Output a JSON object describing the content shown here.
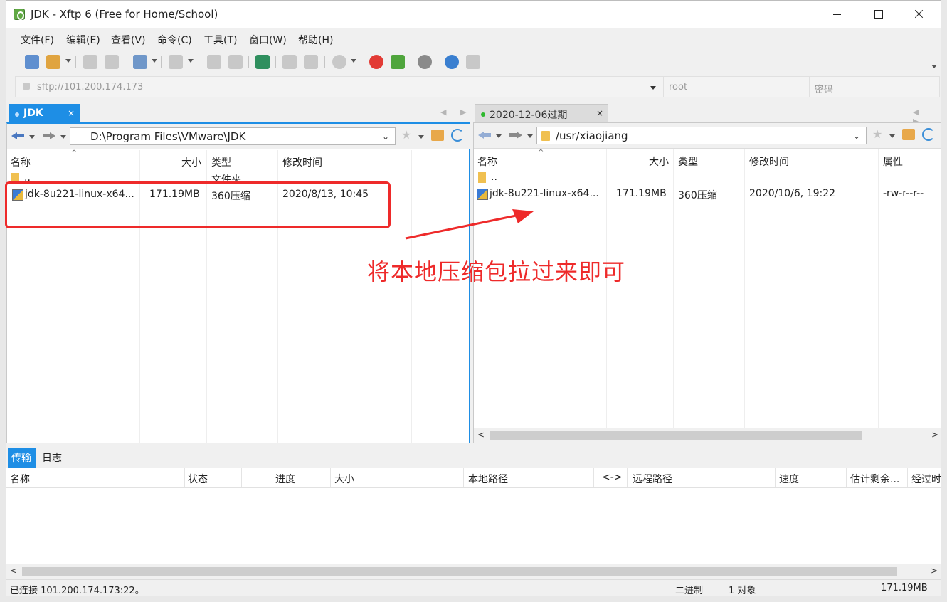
{
  "window": {
    "title": "JDK - Xftp 6 (Free for Home/School)"
  },
  "menu": [
    "文件(F)",
    "编辑(E)",
    "查看(V)",
    "命令(C)",
    "工具(T)",
    "窗口(W)",
    "帮助(H)"
  ],
  "address_bar": {
    "host": "sftp://101.200.174.173",
    "user_placeholder": "root",
    "password_placeholder": "密码"
  },
  "tabs": {
    "left": {
      "label": "JDK",
      "close": "×"
    },
    "right": {
      "label": "2020-12-06过期",
      "close": "×"
    },
    "nav_arrows": "◀ ▶"
  },
  "left_pane": {
    "path": "D:\\Program Files\\VMware\\JDK",
    "columns": [
      "名称",
      "大小",
      "类型",
      "修改时间"
    ],
    "sort_indicator": "^",
    "rows": [
      {
        "name": "..",
        "size": "",
        "type": "文件夹",
        "modified": ""
      },
      {
        "name": "jdk-8u221-linux-x64...",
        "size": "171.19MB",
        "type": "360压缩",
        "modified": "2020/8/13, 10:45"
      }
    ]
  },
  "right_pane": {
    "path": "/usr/xiaojiang",
    "columns": [
      "名称",
      "大小",
      "类型",
      "修改时间",
      "属性"
    ],
    "sort_indicator": "^",
    "rows": [
      {
        "name": "..",
        "size": "",
        "type": "",
        "modified": "",
        "attr": ""
      },
      {
        "name": "jdk-8u221-linux-x64...",
        "size": "171.19MB",
        "type": "360压缩",
        "modified": "2020/10/6, 19:22",
        "attr": "-rw-r--r--"
      }
    ],
    "scroll_left": "<",
    "scroll_right": ">"
  },
  "annotation": {
    "text": "将本地压缩包拉过来即可",
    "color": "#ee2a2a"
  },
  "transfer": {
    "tabs": [
      "传输",
      "日志"
    ],
    "columns": [
      "名称",
      "状态",
      "进度",
      "大小",
      "本地路径",
      "<->",
      "远程路径",
      "速度",
      "估计剩余...",
      "经过时间"
    ],
    "scroll_left": "<",
    "scroll_right": ">"
  },
  "status": {
    "connection": "已连接 101.200.174.173:22。",
    "mode": "二进制",
    "objects": "1 对象",
    "size": "171.19MB"
  },
  "colors": {
    "accent": "#1e8ee5",
    "annotation": "#ee2a2a"
  },
  "icons": [
    "app-icon",
    "new-session-icon",
    "open-folder-icon",
    "connect-icon",
    "disconnect-icon",
    "new-window-icon",
    "transfer-icon",
    "sync-icon",
    "refresh-icon",
    "home-icon",
    "star-icon",
    "help-icon",
    "chat-icon",
    "settings-icon",
    "folder-icon",
    "archive-file-icon"
  ]
}
